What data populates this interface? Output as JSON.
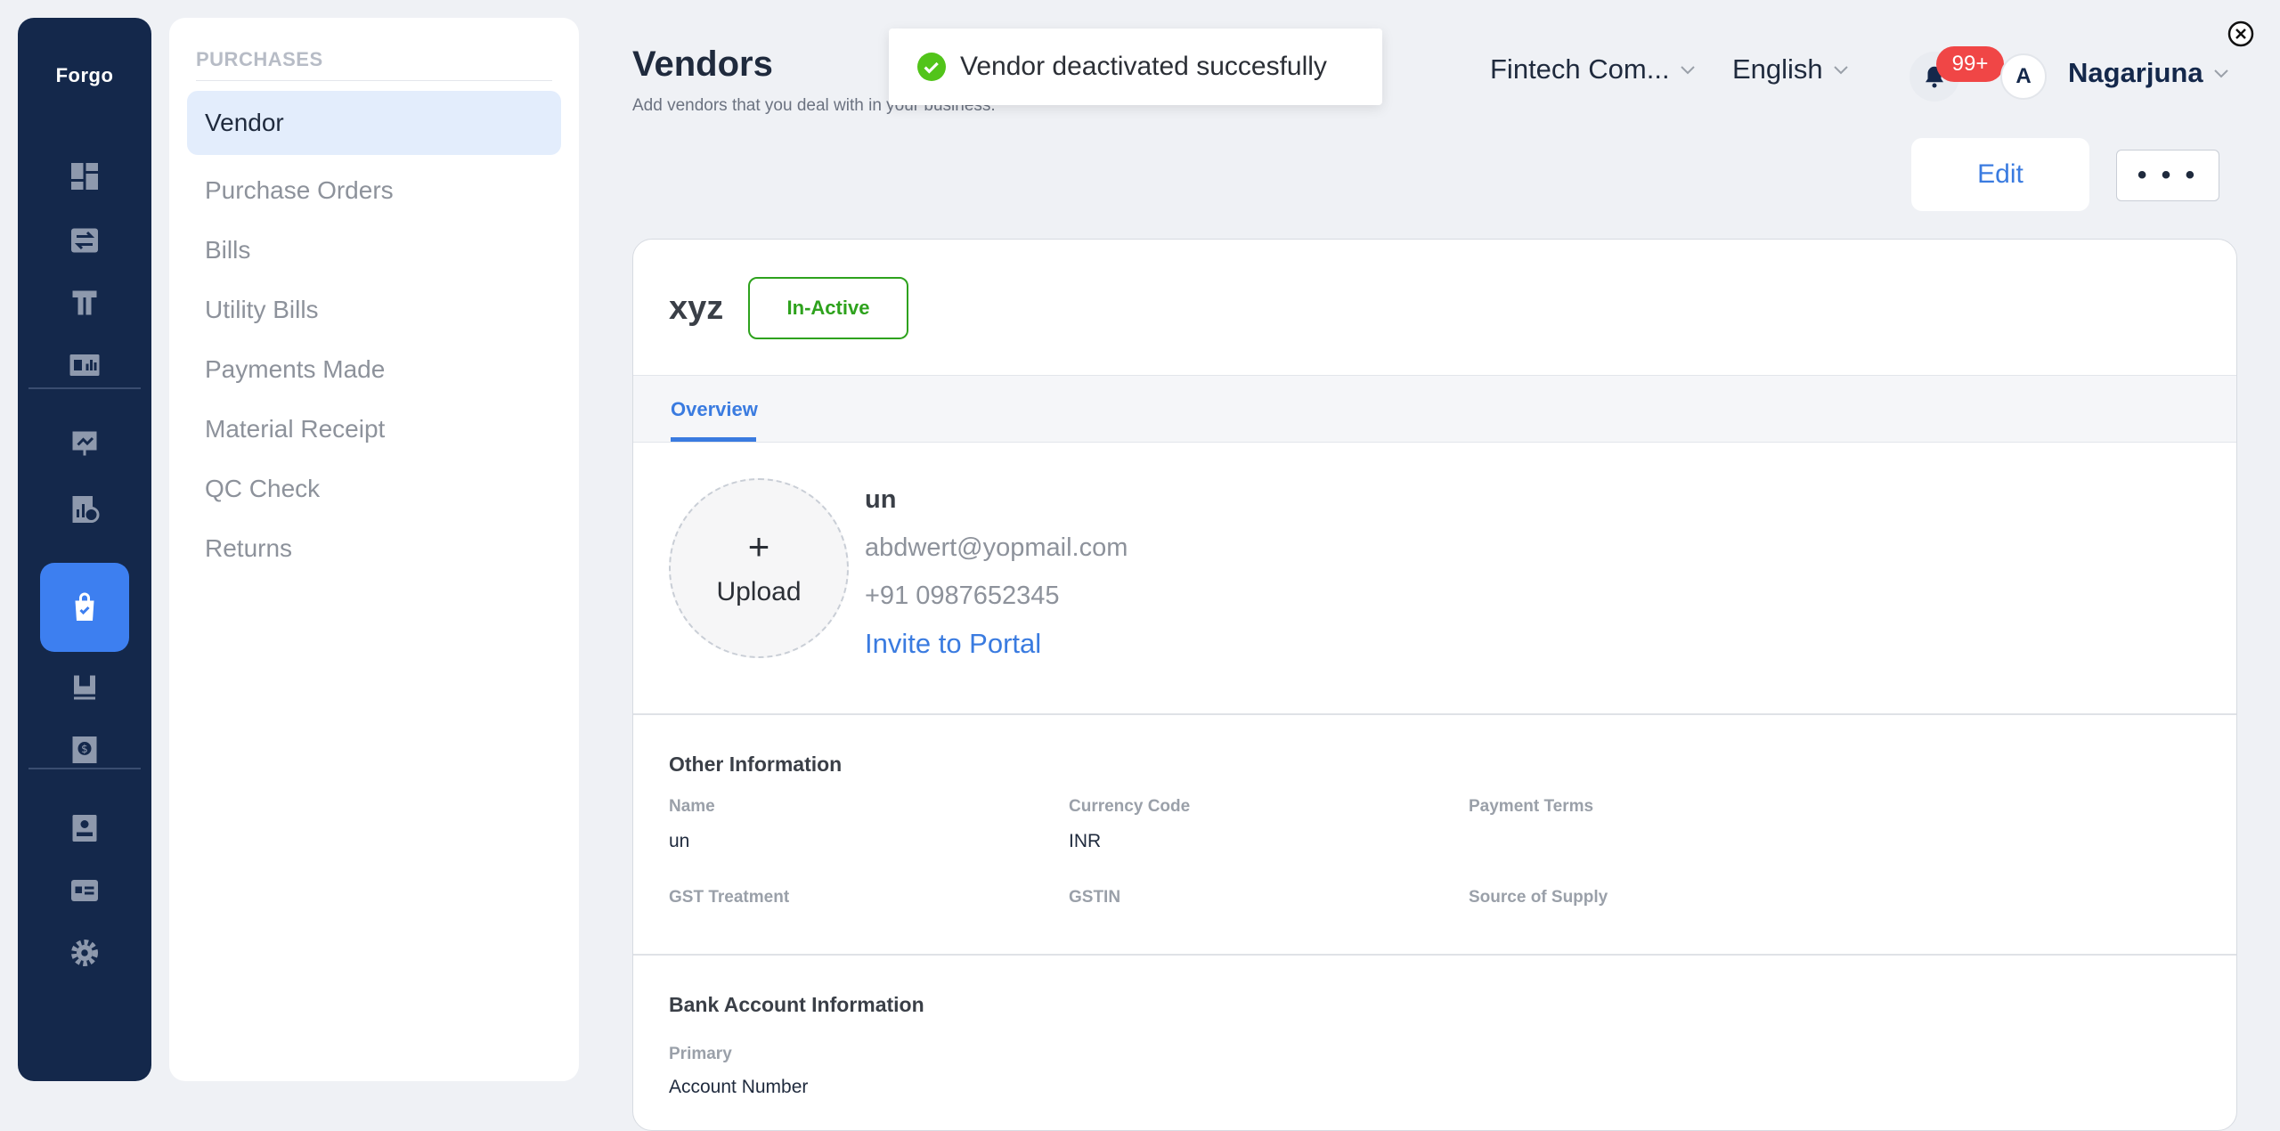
{
  "brand": "Forgo",
  "rail_icons": [
    "dashboard-icon",
    "transfer-icon",
    "inventory-icon",
    "reports-icon",
    "presentation-icon",
    "analytics-icon",
    "purchases-icon",
    "expenses-icon",
    "receipt-icon",
    "contacts-icon",
    "cards-icon",
    "settings-icon"
  ],
  "subnav": {
    "heading": "PURCHASES",
    "items": [
      {
        "label": "Vendor",
        "active": true
      },
      {
        "label": "Purchase Orders"
      },
      {
        "label": "Bills"
      },
      {
        "label": "Utility Bills"
      },
      {
        "label": "Payments Made"
      },
      {
        "label": "Material Receipt"
      },
      {
        "label": "QC Check"
      },
      {
        "label": "Returns"
      }
    ]
  },
  "header": {
    "title": "Vendors",
    "subtitle": "Add vendors that you deal with in your business.",
    "organization": "Fintech Com...",
    "language": "English",
    "notification_count": "99+",
    "avatar_initial": "A",
    "username": "Nagarjuna",
    "edit_label": "Edit",
    "more_label": "• • •"
  },
  "toast": {
    "message": "Vendor deactivated succesfully",
    "color": "#52c41a"
  },
  "vendor": {
    "name": "xyz",
    "status": "In-Active",
    "status_color": "#2ea21d",
    "tab": "Overview",
    "upload_plus": "+",
    "upload_label": "Upload",
    "contact_name": "un",
    "email": "abdwert@yopmail.com",
    "phone": "+91 0987652345",
    "invite_label": "Invite to Portal"
  },
  "other_info": {
    "title": "Other Information",
    "fields": [
      {
        "label": "Name",
        "value": "un"
      },
      {
        "label": "Currency Code",
        "value": "INR"
      },
      {
        "label": "Payment Terms",
        "value": ""
      },
      {
        "label": "GST Treatment",
        "value": ""
      },
      {
        "label": "GSTIN",
        "value": ""
      },
      {
        "label": "Source of Supply",
        "value": ""
      }
    ]
  },
  "bank_info": {
    "title": "Bank Account Information",
    "primary_label": "Primary",
    "account_number_label": "Account Number"
  }
}
